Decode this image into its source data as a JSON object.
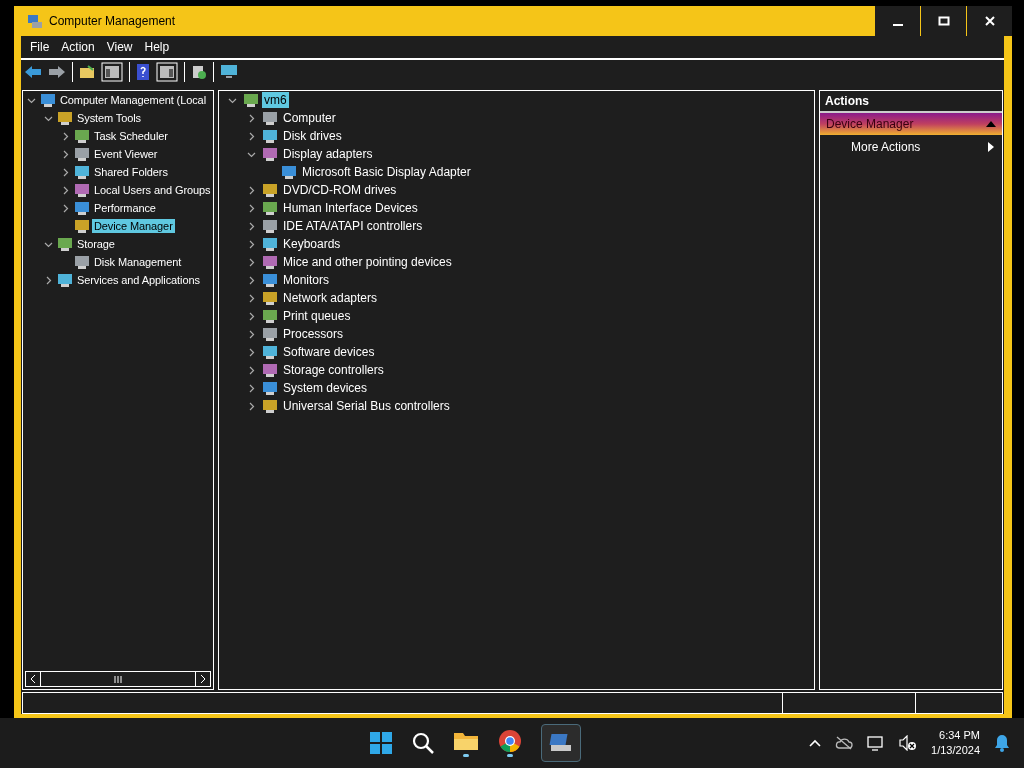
{
  "window": {
    "title": "Computer Management"
  },
  "menu": [
    "File",
    "Action",
    "View",
    "Help"
  ],
  "navigation_tree": [
    {
      "label": "Computer Management (Local",
      "expanded": true,
      "selected": false,
      "children": [
        {
          "label": "System Tools",
          "expanded": true,
          "selected": false,
          "children": [
            {
              "label": "Task Scheduler",
              "expanded": false,
              "selected": false
            },
            {
              "label": "Event Viewer",
              "expanded": false,
              "selected": false
            },
            {
              "label": "Shared Folders",
              "expanded": false,
              "selected": false
            },
            {
              "label": "Local Users and Groups",
              "expanded": false,
              "selected": false
            },
            {
              "label": "Performance",
              "expanded": false,
              "selected": false
            },
            {
              "label": "Device Manager",
              "selected": true
            }
          ]
        },
        {
          "label": "Storage",
          "expanded": true,
          "selected": false,
          "children": [
            {
              "label": "Disk Management",
              "selected": false
            }
          ]
        },
        {
          "label": "Services and Applications",
          "expanded": false,
          "selected": false
        }
      ]
    }
  ],
  "device_tree": [
    {
      "label": "vm6",
      "expanded": true,
      "selected": true,
      "children": [
        {
          "label": "Computer",
          "expanded": false,
          "selected": false
        },
        {
          "label": "Disk drives",
          "expanded": false,
          "selected": false
        },
        {
          "label": "Display adapters",
          "expanded": true,
          "selected": false,
          "children": [
            {
              "label": "Microsoft Basic Display Adapter",
              "selected": false
            }
          ]
        },
        {
          "label": "DVD/CD-ROM drives",
          "expanded": false,
          "selected": false
        },
        {
          "label": "Human Interface Devices",
          "expanded": false,
          "selected": false
        },
        {
          "label": "IDE ATA/ATAPI controllers",
          "expanded": false,
          "selected": false
        },
        {
          "label": "Keyboards",
          "expanded": false,
          "selected": false
        },
        {
          "label": "Mice and other pointing devices",
          "expanded": false,
          "selected": false
        },
        {
          "label": "Monitors",
          "expanded": false,
          "selected": false
        },
        {
          "label": "Network adapters",
          "expanded": false,
          "selected": false
        },
        {
          "label": "Print queues",
          "expanded": false,
          "selected": false
        },
        {
          "label": "Processors",
          "expanded": false,
          "selected": false
        },
        {
          "label": "Software devices",
          "expanded": false,
          "selected": false
        },
        {
          "label": "Storage controllers",
          "expanded": false,
          "selected": false
        },
        {
          "label": "System devices",
          "expanded": false,
          "selected": false
        },
        {
          "label": "Universal Serial Bus controllers",
          "expanded": false,
          "selected": false
        }
      ]
    }
  ],
  "actions": {
    "title": "Actions",
    "sections": [
      {
        "label": "Device Manager",
        "expanded": true,
        "items": [
          {
            "label": "More Actions"
          }
        ]
      }
    ]
  },
  "taskbar": {
    "time": "6:34 PM",
    "date": "1/13/2024"
  }
}
